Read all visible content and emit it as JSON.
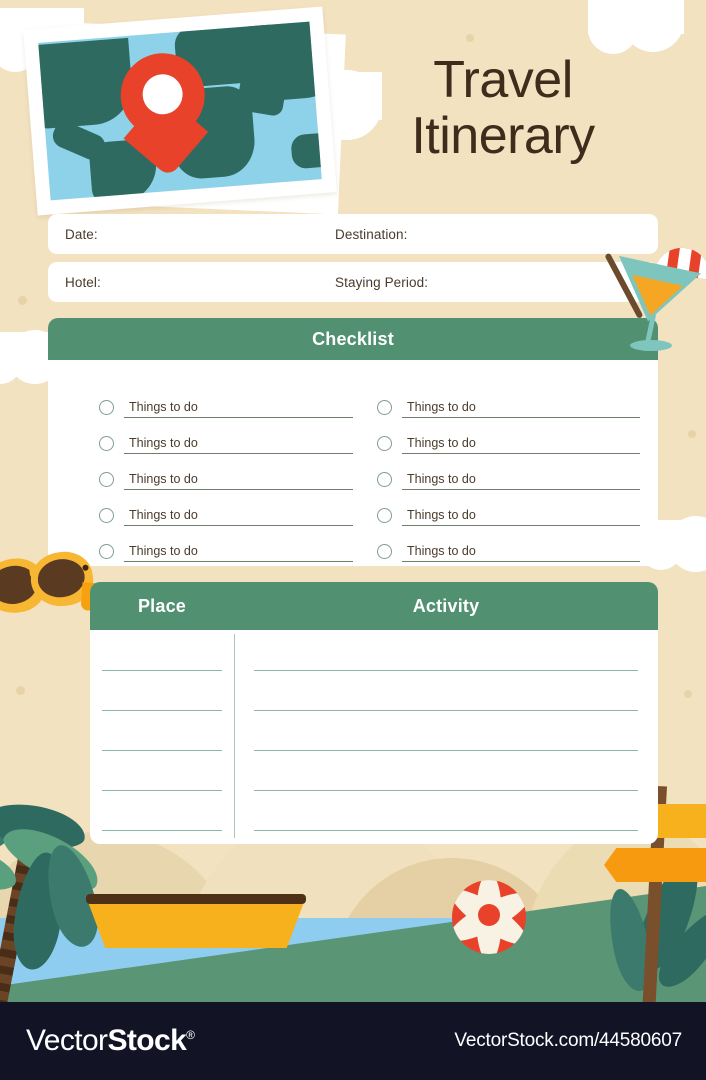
{
  "page": {
    "title_line1": "Travel",
    "title_line2": "Itinerary"
  },
  "fields": [
    {
      "left_label": "Date:",
      "right_label": "Destination:"
    },
    {
      "left_label": "Hotel:",
      "right_label": "Staying Period:"
    }
  ],
  "checklist": {
    "heading": "Checklist",
    "left_items": [
      "Things to do",
      "Things to do",
      "Things to do",
      "Things to do",
      "Things to do"
    ],
    "right_items": [
      "Things to do",
      "Things to do",
      "Things to do",
      "Things to do",
      "Things to do"
    ]
  },
  "table": {
    "col1_header": "Place",
    "col2_header": "Activity",
    "row_count": 5,
    "rows": [
      {
        "place": "",
        "activity": ""
      },
      {
        "place": "",
        "activity": ""
      },
      {
        "place": "",
        "activity": ""
      },
      {
        "place": "",
        "activity": ""
      },
      {
        "place": "",
        "activity": ""
      }
    ]
  },
  "footer": {
    "brand_part1": "Vector",
    "brand_part2": "Stock",
    "registered_mark": "®",
    "url": "VectorStock.com/44580607"
  },
  "colors": {
    "background": "#f2e2c0",
    "accent_green": "#519070",
    "title_brown": "#402b1c",
    "panel_white": "#ffffff",
    "map_ocean": "#8ed2ea",
    "map_land": "#2e6a60",
    "pin_red": "#e8432a",
    "sand_dune": "#e5d0a5",
    "water_blue": "#8ecdf0",
    "grass_green": "#5a9575",
    "boat_yellow": "#f7b11c",
    "footer_navy": "#131326",
    "line_green": "#8ab79d",
    "checkbox_outline": "#7f9e90"
  },
  "icons": {
    "map_pin": "map-pin-icon",
    "cocktail": "cocktail-glass-icon",
    "sunglasses": "sunglasses-icon",
    "palm_tree": "palm-tree-icon",
    "boat": "boat-icon",
    "beach_ball": "beach-ball-icon",
    "signpost": "signpost-icon",
    "cloud": "cloud-icon"
  }
}
